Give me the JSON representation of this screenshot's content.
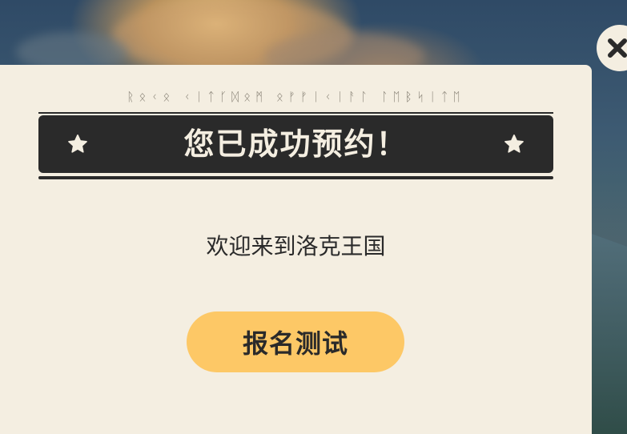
{
  "dialog": {
    "runes_text": "ᚱᛟᚲᛟ ᚲᛁᛏᚴᛞᛟᛗ ᛟᚠᚠᛁᚲᛁᚨᛚ ᛚᛖᛒᛋᛁᛏᛖ",
    "title": "您已成功预约！",
    "welcome_text": "欢迎来到洛克王国",
    "register_button_label": "报名测试"
  },
  "icons": {
    "close": "close-icon",
    "star": "star-icon"
  },
  "colors": {
    "panel_background": "#f4eee1",
    "banner_background": "#2a2a2a",
    "banner_text": "#f4eee1",
    "button_background": "#fdc866",
    "text_dark": "#2a2a2a"
  }
}
